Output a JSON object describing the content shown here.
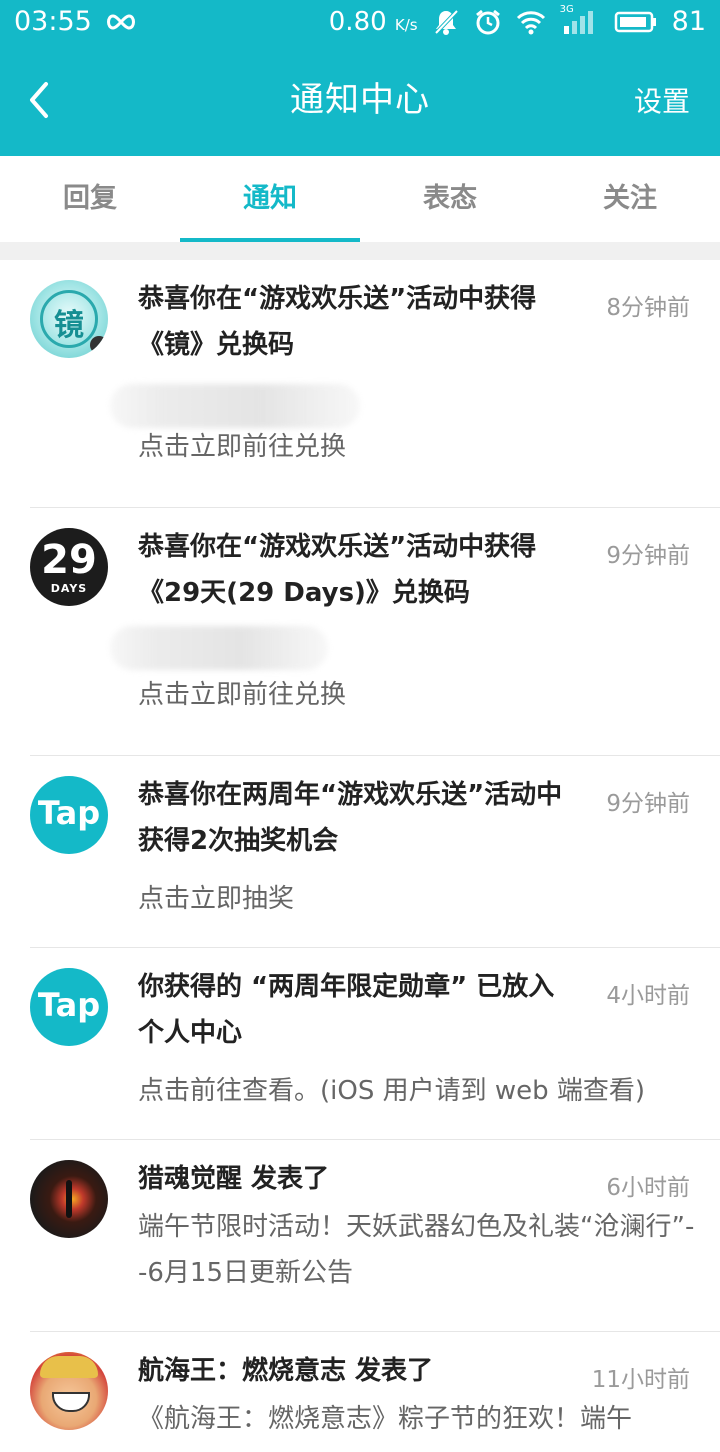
{
  "status_bar": {
    "time": "03:55",
    "speed": "0.80",
    "speed_unit": "K/s",
    "network": "3G",
    "battery": "81"
  },
  "app_bar": {
    "title": "通知中心",
    "settings_label": "设置"
  },
  "tabs": [
    {
      "label": "回复"
    },
    {
      "label": "通知",
      "active": true
    },
    {
      "label": "表态"
    },
    {
      "label": "关注"
    }
  ],
  "notifications": [
    {
      "avatar": "镜",
      "title": "恭喜你在“游戏欢乐送”活动中获得《镜》兑换码",
      "time": "8分钟前",
      "action": "点击立即前往兑换"
    },
    {
      "avatar": "29",
      "avatar_sub": "DAYS",
      "title": "恭喜你在“游戏欢乐送”活动中获得《29天(29 Days)》兑换码",
      "time": "9分钟前",
      "action": "点击立即前往兑换"
    },
    {
      "avatar": "Tap",
      "title": "恭喜你在两周年“游戏欢乐送”活动中获得2次抽奖机会",
      "time": "9分钟前",
      "action": "点击立即抽奖"
    },
    {
      "avatar": "Tap",
      "title": "你获得的 “两周年限定勋章” 已放入个人中心",
      "time": "4小时前",
      "action": "点击前往查看。(iOS 用户请到 web 端查看)"
    },
    {
      "title": "猎魂觉醒 发表了",
      "time": "6小时前",
      "action": "端午节限时活动！天妖武器幻色及礼装“沧澜行”--6月15日更新公告"
    },
    {
      "title": "航海王：燃烧意志 发表了",
      "time": "11小时前",
      "action": "《航海王：燃烧意志》粽子节的狂欢！端午"
    }
  ],
  "colors": {
    "accent": "#14b9c8"
  }
}
